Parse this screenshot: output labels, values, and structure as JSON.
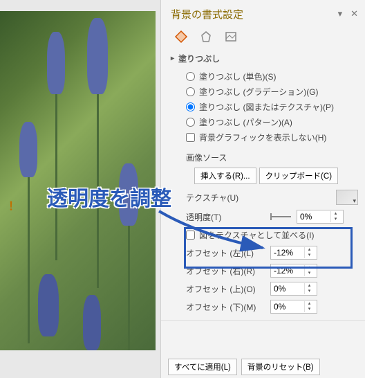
{
  "panel": {
    "title": "背景の書式設定",
    "section": "塗りつぶし",
    "radios": [
      {
        "label": "塗りつぶし (単色)(S)"
      },
      {
        "label": "塗りつぶし (グラデーション)(G)"
      },
      {
        "label": "塗りつぶし (図またはテクスチャ)(P)"
      },
      {
        "label": "塗りつぶし (パターン)(A)"
      }
    ],
    "checkbox": "背景グラフィックを表示しない(H)",
    "image_source": "画像ソース",
    "insert_btn": "挿入する(R)...",
    "clipboard_btn": "クリップボード(C)",
    "texture_label": "テクスチャ(U)",
    "transparency_label": "透明度(T)",
    "transparency_value": "0%",
    "tile_label": "図をテクスチャとして並べる(I)",
    "offset_left_label": "オフセット (左)(L)",
    "offset_left_value": "-12%",
    "offset_right_label": "オフセット (右)(R)",
    "offset_right_value": "-12%",
    "offset_top_label": "オフセット (上)(O)",
    "offset_top_value": "0%",
    "offset_bottom_label": "オフセット (下)(M)",
    "offset_bottom_value": "0%",
    "apply_all": "すべてに適用(L)",
    "reset_bg": "背景のリセット(B)"
  },
  "annotation": "透明度を調整",
  "slide_hint": "！"
}
